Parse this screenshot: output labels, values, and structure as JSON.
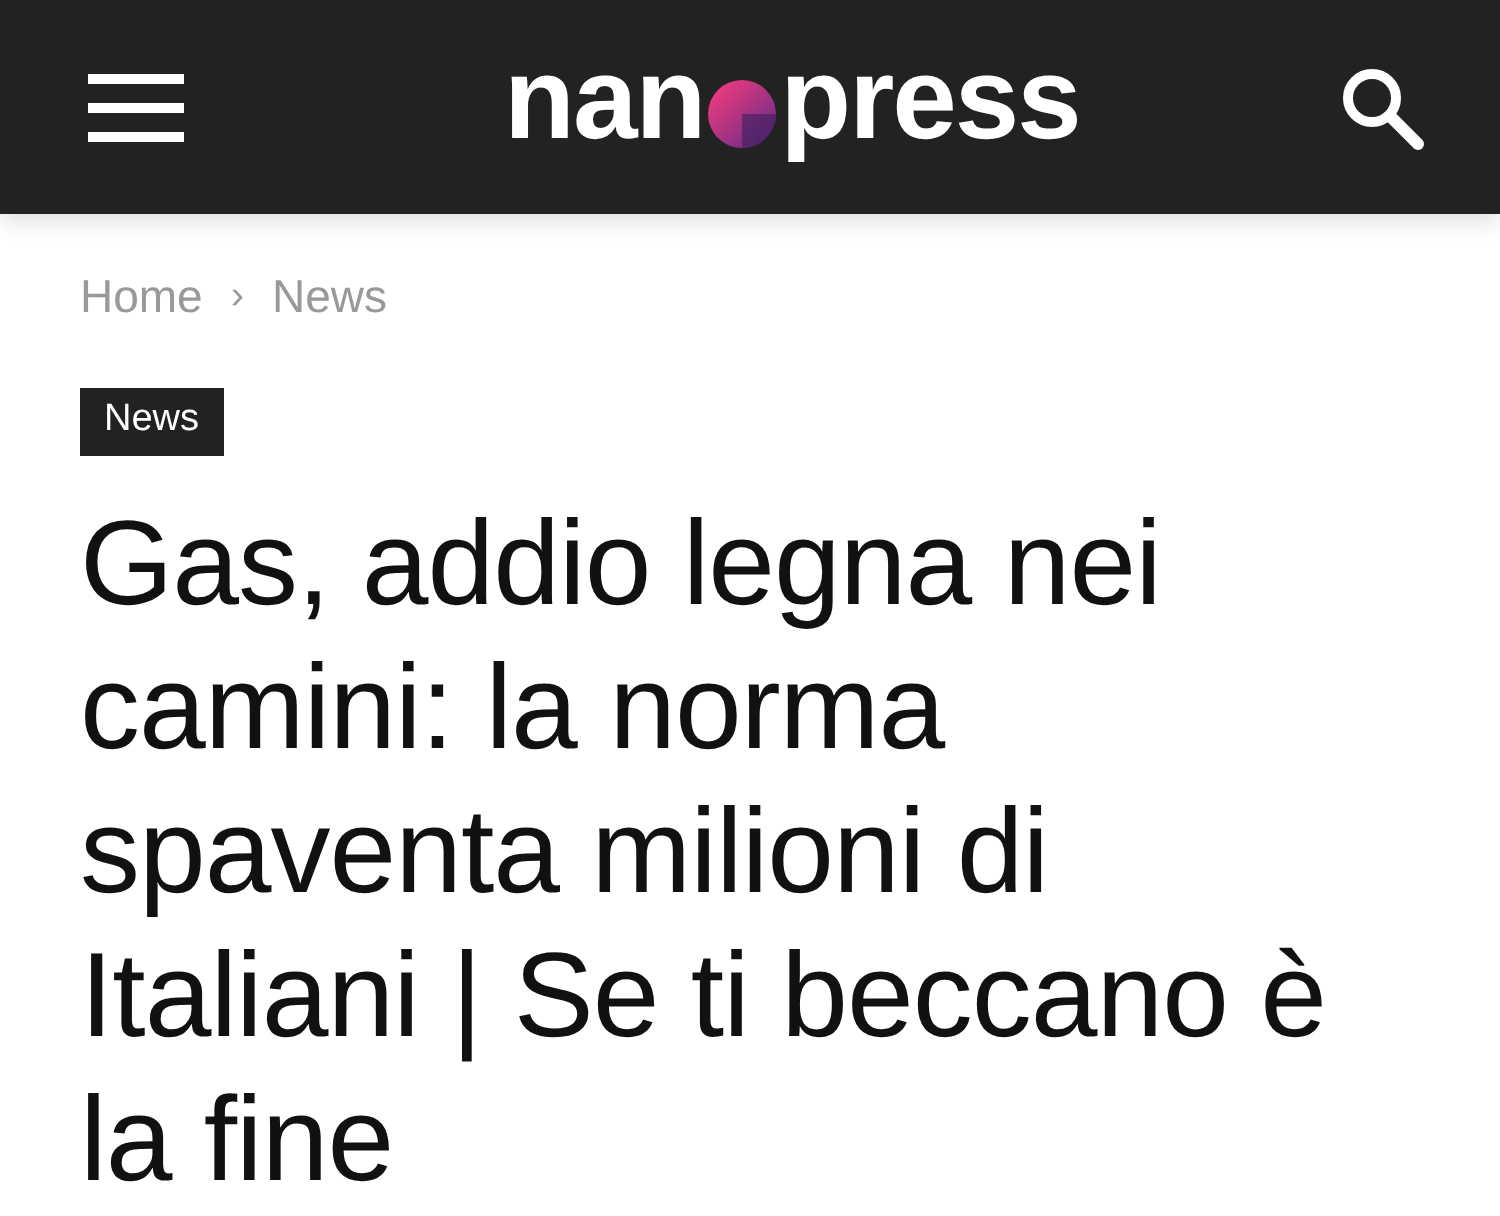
{
  "header": {
    "logo": {
      "left": "nan",
      "right": "press"
    }
  },
  "breadcrumb": {
    "items": [
      "Home",
      "News"
    ],
    "separator": "›"
  },
  "article": {
    "category": "News",
    "title": "Gas, addio legna nei camini: la norma spaventa milioni di Italiani | Se ti beccano è la fine"
  }
}
